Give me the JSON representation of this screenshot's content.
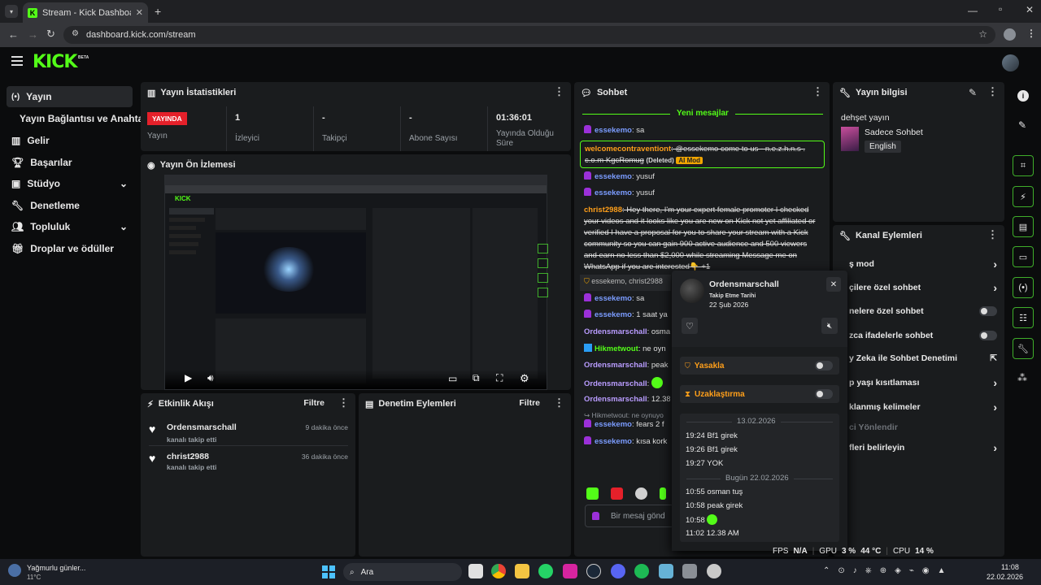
{
  "browser": {
    "tab_title": "Stream - Kick Dashboard",
    "url": "dashboard.kick.com/stream"
  },
  "brand": {
    "logo": "KICK",
    "beta": "BETA",
    "accent": "#53fc18"
  },
  "sidebar": {
    "items": [
      {
        "label": "Yayın",
        "icon": "broadcast-icon"
      },
      {
        "label": "Yayın Bağlantısı ve Anahtarı"
      },
      {
        "label": "Gelir",
        "icon": "chart-icon"
      },
      {
        "label": "Başarılar",
        "icon": "trophy-icon"
      },
      {
        "label": "Stüdyo",
        "icon": "tv-icon"
      },
      {
        "label": "Denetleme",
        "icon": "wrench-icon"
      },
      {
        "label": "Topluluk",
        "icon": "users-icon"
      },
      {
        "label": "Droplar ve ödüller",
        "icon": "gift-icon"
      }
    ]
  },
  "stats": {
    "title": "Yayın İstatistikleri",
    "live_badge": "YAYINDA",
    "live_label": "Yayın",
    "viewers_value": "1",
    "viewers_label": "İzleyici",
    "followers_value": "-",
    "followers_label": "Takipçi",
    "subs_value": "-",
    "subs_label": "Abone Sayısı",
    "uptime_value": "01:36:01",
    "uptime_label": "Yayında Olduğu Süre"
  },
  "preview": {
    "title": "Yayın Ön İzlemesi"
  },
  "activity": {
    "title": "Etkinlik Akışı",
    "filter": "Filtre",
    "items": [
      {
        "user": "Ordensmarschall",
        "action": "kanalı takip etti",
        "time": "9 dakika önce"
      },
      {
        "user": "christ2988",
        "action": "kanalı takip etti",
        "time": "36 dakika önce"
      }
    ]
  },
  "moderation": {
    "title": "Denetim Eylemleri",
    "filter": "Filtre"
  },
  "chat": {
    "title": "Sohbet",
    "new_messages": "Yeni mesajlar",
    "m1_user": "essekemo",
    "m1_text": ": sa",
    "m2_user": "welcomecontraventiont",
    "m2_text": ": @essekemo come to us - n.e.z.h.n.s . c.o.m KgcRomug",
    "m2_deleted": "(Deleted)",
    "m2_badge": "AI Mod",
    "m3_user": "essekemo",
    "m3_text": ": yusuf",
    "m4_user": "essekemo",
    "m4_text": ": yusuf",
    "m5_user": "christ2988",
    "m5_text": ": Hey there, I'm your expert female promoter I checked your videos and it looks like you are new on Kick not yet affiliated or verified I have a proposal for you to share your stream with a Kick community so you can gain 900 active audience and 500 viewers and earn no less than $2,000 while streaming Message me on WhatsApp if you are interested👇 +1",
    "m6_text": "essekemo, christ2988",
    "m7_user": "essekemo",
    "m7_text": ": sa",
    "m8_user": "essekemo",
    "m8_text": ": 1 saat ya",
    "m9_user": "Ordensmarschall",
    "m9_text": ": osma",
    "m10_user": "Hikmetwout",
    "m10_text": ": ne oyn",
    "m11_user": "Ordensmarschall",
    "m11_text": ": peak",
    "m12_user": "Ordensmarschall",
    "m12_text": ":",
    "m13_user": "Ordensmarschall",
    "m13_text": ": 12.38",
    "m14_reply": "Hikmetwout: ne oynuyo",
    "m14_user": "essekemo",
    "m14_text": ": fears 2 f",
    "m15_user": "essekemo",
    "m15_text": ": kısa kork",
    "placeholder": "Bir mesaj gönd"
  },
  "popup": {
    "username": "Ordensmarschall",
    "follow_label": "Takip Etme Tarihi",
    "follow_date": "22 Şub 2026",
    "ban_label": "Yasakla",
    "timeout_label": "Uzaklaştırma",
    "date1": "13.02.2026",
    "log1": [
      "19:24 Bf1 girek",
      "19:26 Bf1 girek",
      "19:27 YOK"
    ],
    "date2": "Bugün 22.02.2026",
    "log2": [
      "10:55 osman tuş",
      "10:58 peak girek",
      "10:58",
      "11:02 12.38 AM"
    ]
  },
  "info": {
    "title": "Yayın bilgisi",
    "stream_title": "dehşet yayın",
    "category": "Sadece Sohbet",
    "language": "English"
  },
  "channel_actions": {
    "title": "Kanal Eylemleri",
    "items": [
      "ş mod",
      "çilere özel sohbet",
      "nelere özel sohbet",
      "zca ifadelerle sohbet",
      "y Zeka ile Sohbet Denetimi",
      "p yaşı kısıtlaması",
      "klanmış kelimeler",
      "ci Yönlendir",
      "fleri belirleyin"
    ]
  },
  "status": {
    "fps_label": "FPS",
    "fps_value": "N/A",
    "gpu_label": "GPU",
    "gpu_value": "3 %",
    "gpu_temp": "44 °C",
    "cpu_label": "CPU",
    "cpu_value": "14 %"
  },
  "taskbar": {
    "weather": "Yağmurlu günler...",
    "temp": "11°C",
    "search": "Ara",
    "time": "11:08",
    "date": "22.02.2026"
  }
}
